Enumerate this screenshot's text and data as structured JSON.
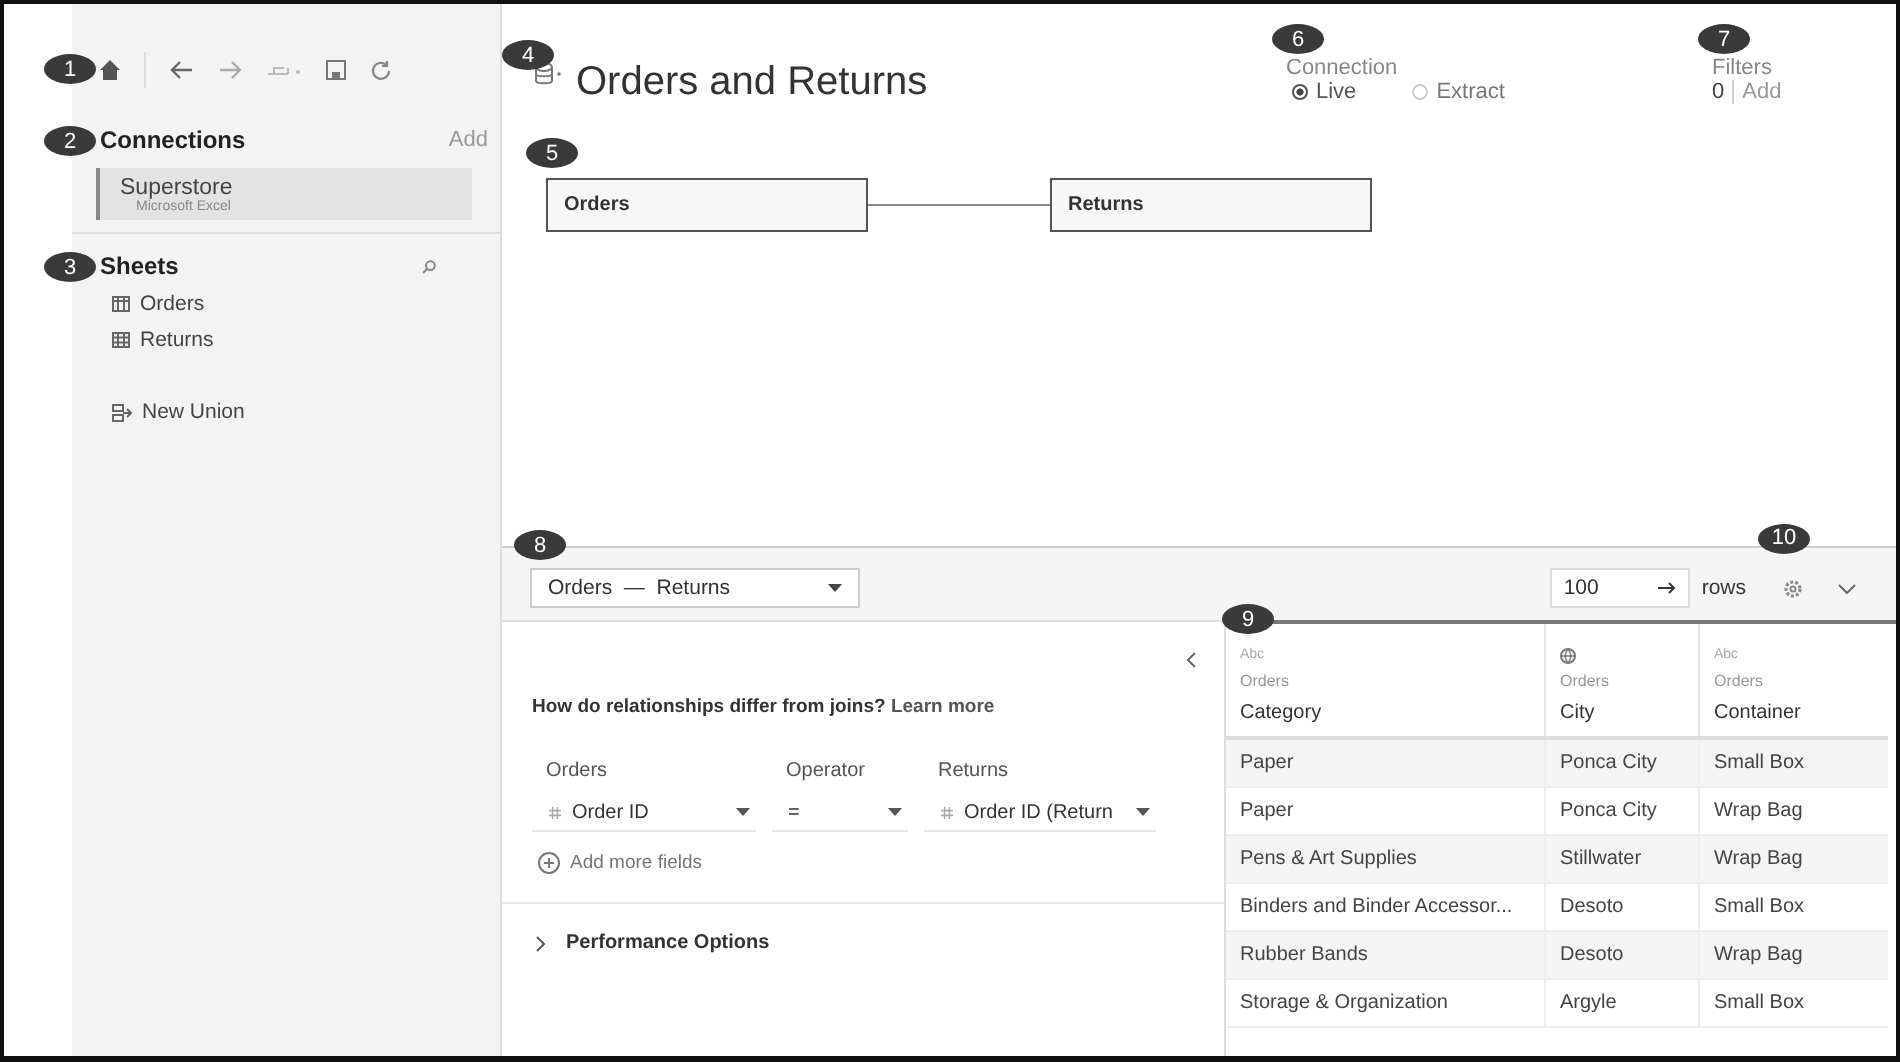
{
  "toolbar": {
    "callout": "1"
  },
  "connections": {
    "callout": "2",
    "title": "Connections",
    "add": "Add",
    "items": [
      {
        "name": "Superstore",
        "type": "Microsoft Excel",
        "selected": true
      }
    ]
  },
  "sheets": {
    "callout": "3",
    "title": "Sheets",
    "items": [
      {
        "name": "Orders",
        "kind": "columns"
      },
      {
        "name": "Returns",
        "kind": "grid"
      }
    ],
    "union": "New Union"
  },
  "datasource": {
    "callout": "4",
    "title": "Orders and Returns"
  },
  "connection": {
    "callout": "6",
    "label": "Connection",
    "options": [
      {
        "label": "Live",
        "selected": true
      },
      {
        "label": "Extract",
        "selected": false
      }
    ]
  },
  "filters": {
    "callout": "7",
    "label": "Filters",
    "count": "0",
    "add": "Add"
  },
  "canvas": {
    "callout": "5",
    "tables": [
      "Orders",
      "Returns"
    ]
  },
  "relationship_bar": {
    "callout": "8",
    "selector": "Orders  —  Returns",
    "rows": "100",
    "rows_label": "rows",
    "settings_callout": "10"
  },
  "relationship": {
    "question": "How do relationships differ from joins?",
    "link": "Learn more",
    "columns": [
      "Orders",
      "Operator",
      "Returns"
    ],
    "fields": [
      "Order ID",
      "=",
      "Order ID (Return"
    ],
    "add": "Add more fields",
    "performance": "Performance Options"
  },
  "grid": {
    "callout": "9",
    "columns": [
      {
        "kind": "string",
        "type_label": "Abc",
        "source": "Orders",
        "name": "Category"
      },
      {
        "kind": "geo",
        "source": "Orders",
        "name": "City"
      },
      {
        "kind": "string",
        "type_label": "Abc",
        "source": "Orders",
        "name": "Container"
      }
    ],
    "rows": [
      [
        "Paper",
        "Ponca City",
        "Small Box"
      ],
      [
        "Paper",
        "Ponca City",
        "Wrap Bag"
      ],
      [
        "Pens & Art Supplies",
        "Stillwater",
        "Wrap Bag"
      ],
      [
        "Binders and Binder Accessor...",
        "Desoto",
        "Small Box"
      ],
      [
        "Rubber Bands",
        "Desoto",
        "Wrap Bag"
      ],
      [
        "Storage & Organization",
        "Argyle",
        "Small Box"
      ]
    ]
  }
}
